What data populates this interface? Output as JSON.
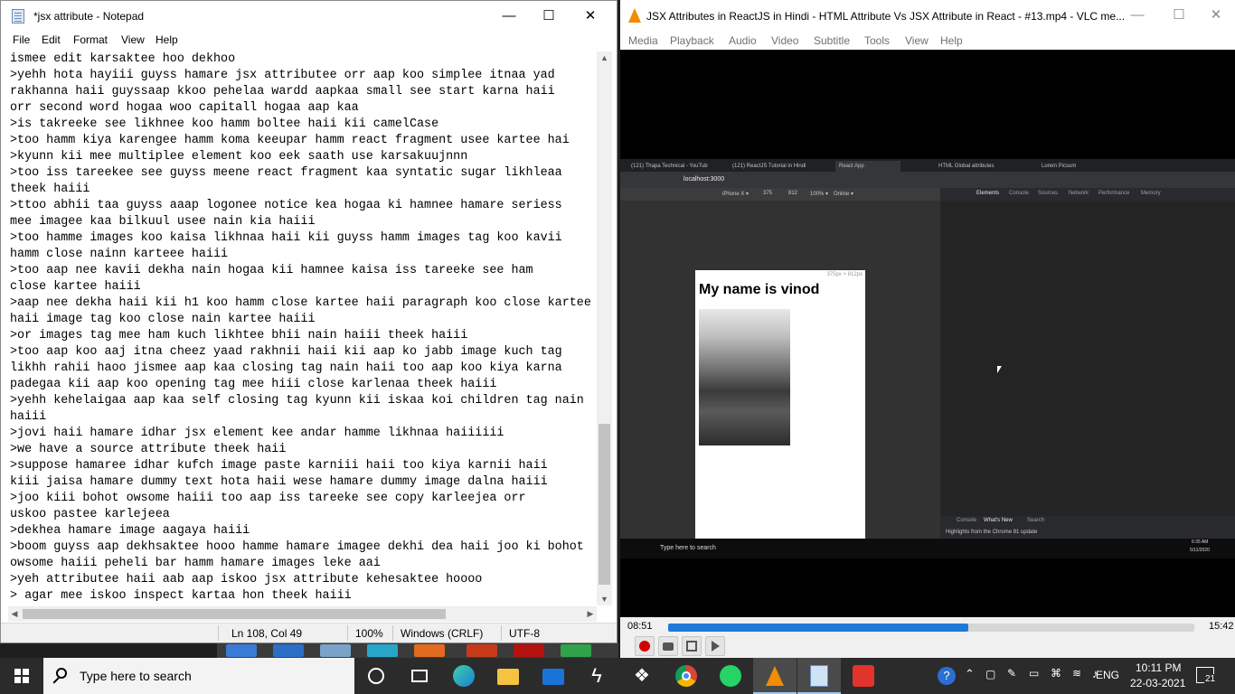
{
  "notepad": {
    "title": "*jsx attribute - Notepad",
    "menu": [
      "File",
      "Edit",
      "Format",
      "View",
      "Help"
    ],
    "lines": [
      "ismee edit karsaktee hoo dekhoo",
      ">yehh hota hayiii guyss hamare jsx attributee orr aap koo simplee itnaa yad",
      "rakhanna haii guyssaap kkoo pehelaa wardd aapkaa small see start karna haii",
      "orr second word hogaa woo capitall hogaa aap kaa",
      ">is takreeke see likhnee koo hamm boltee haii kii camelCase",
      ">too hamm kiya karengee hamm koma keeupar hamm react fragment usee kartee hai",
      ">kyunn kii mee multiplee element koo eek saath use karsakuujnnn",
      ">too iss tareekee see guyss meene react fragment kaa syntatic sugar likhleaa",
      "theek haiii",
      ">ttoo abhii taa guyss aaap logonee notice kea hogaa ki hamnee hamare seriess",
      "mee imagee kaa bilkuul usee nain kia haiii",
      ">too hamme images koo kaisa likhnaa haii kii guyss hamm images tag koo kavii",
      "hamm close nainn karteee haiii",
      ">too aap nee kavii dekha nain hogaa kii hamnee kaisa iss tareeke see ham",
      "close kartee haiii",
      ">aap nee dekha haii kii h1 koo hamm close kartee haii paragraph koo close kartee",
      "haii image tag koo close nain kartee haiii",
      ">or images tag mee ham kuch likhtee bhii nain haiii theek haiii",
      ">too aap koo aaj itna cheez yaad rakhnii haii kii aap ko jabb image kuch tag",
      "likhh rahii haoo jismee aap kaa closing tag nain haii too aap koo kiya karna",
      "padegaa kii aap koo opening tag mee hiii close karlenaa theek haiii",
      ">yehh kehelaigaa aap kaa self closing tag kyunn kii iskaa koi children tag nain",
      "haiii",
      ">jovi haii hamare idhar jsx element kee andar hamme likhnaa haiiiiii",
      ">we have a source attribute theek haii",
      ">suppose hamaree idhar kufch image paste karniii haii too kiya karnii haii",
      "kiii jaisa hamare dummy text hota haii wese hamare dummy image dalna haiii",
      ">joo kiii bohot owsome haiii too aap iss tareeke see copy karleejea orr",
      "uskoo pastee karlejeea",
      ">dekhea hamare image aagaya haiii",
      ">boom guyss aap dekhsaktee hooo hamme hamare imagee dekhi dea haii joo ki bohot",
      "owsome haiii peheli bar hamm hamare images leke aai",
      ">yeh attributee haii aab aap iskoo jsx attribute kehesaktee hoooo",
      "> agar mee iskoo inspect kartaa hon theek haiii"
    ],
    "status": {
      "position": "Ln 108, Col 49",
      "zoom": "100%",
      "line_ending": "Windows (CRLF)",
      "encoding": "UTF-8"
    },
    "window_buttons": {
      "minimize": "—",
      "maximize": "☐",
      "close": "✕"
    }
  },
  "vlc": {
    "title": "JSX Attributes in ReactJS in Hindi - HTML Attribute Vs JSX Attribute in React  - #13.mp4 - VLC me...",
    "menu": [
      "Media",
      "Playback",
      "Audio",
      "Video",
      "Subtitle",
      "Tools",
      "View",
      "Help"
    ],
    "time_elapsed": "08:51",
    "time_total": "15:42",
    "progress": 0.57,
    "embedded": {
      "tabs": [
        "(121) Thapa Technical - YouTub",
        "(121) ReactJS Tutorial in Hindi",
        "React App",
        "HTML Global attributes",
        "Lorem Picsum"
      ],
      "url": "localhost:3000",
      "device": "iPhone X ▾",
      "device_w": "375",
      "device_h": "812",
      "device_zoom": "100% ▾",
      "device_net": "Online ▾",
      "viewport_label": "375px × 812px",
      "heading": "My name is vinod",
      "devtools_tabs": [
        "Elements",
        "Console",
        "Sources",
        "Network",
        "Performance",
        "Memory"
      ],
      "drawer_tabs": [
        "Console",
        "What's New",
        "Search"
      ],
      "drawer_text": "Highlights from the Chrome 81 update",
      "taskbar_search": "Type here to search",
      "clock_time": "6:35 AM",
      "clock_date": "5/11/2020"
    }
  },
  "taskbar": {
    "search_placeholder": "Type here to search",
    "lang": "ENG",
    "time": "10:11 PM",
    "date": "22-03-2021",
    "notifications": "21"
  },
  "colors": {
    "taskbar": "#2b2b2b",
    "vlc_progress": "#1e7ad6",
    "vlc_cone": "#f28c00"
  }
}
